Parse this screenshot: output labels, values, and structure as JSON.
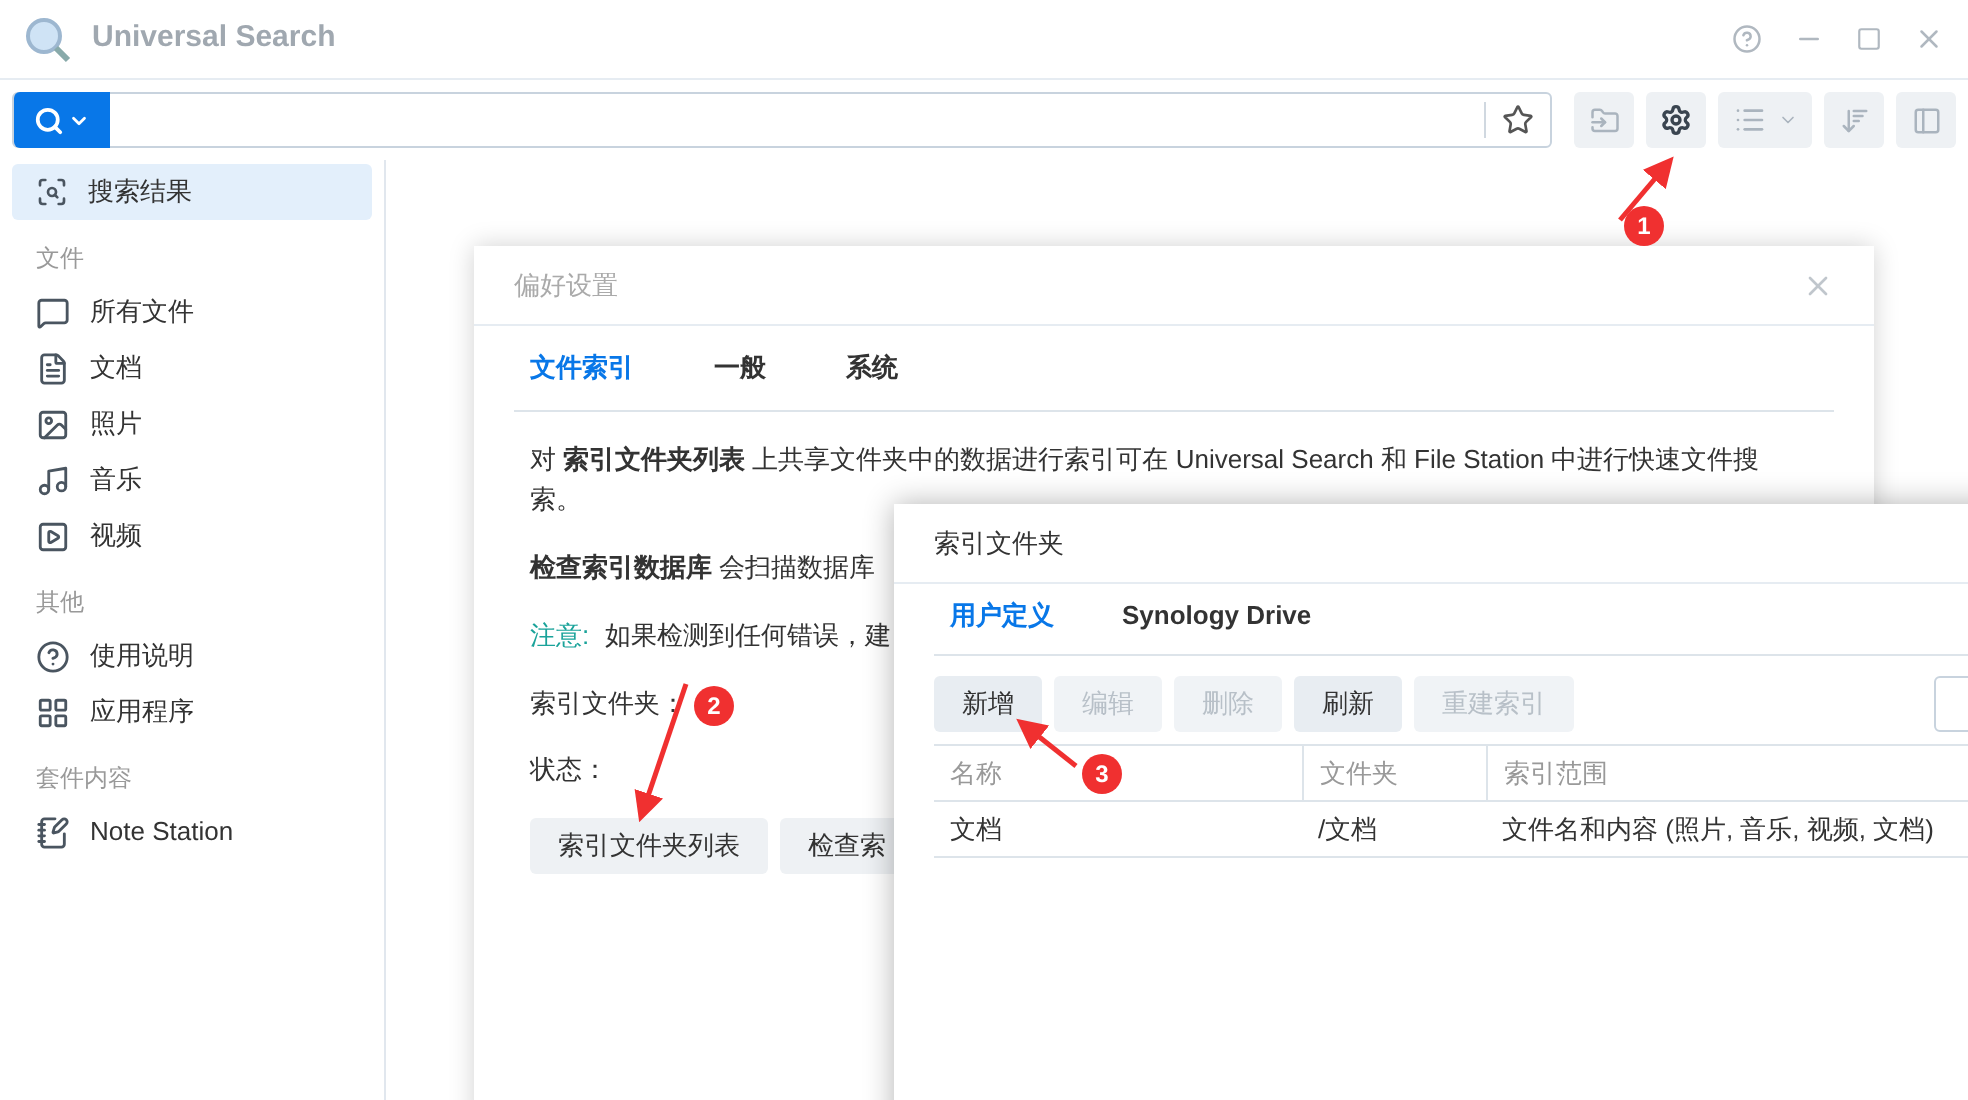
{
  "window": {
    "title": "Universal Search"
  },
  "sidebar": {
    "items": [
      {
        "label": "搜索结果",
        "selected": true
      }
    ],
    "sections": [
      {
        "heading": "文件",
        "items": [
          {
            "label": "所有文件",
            "selected": false
          },
          {
            "label": "文档",
            "selected": false
          },
          {
            "label": "照片",
            "selected": false
          },
          {
            "label": "音乐",
            "selected": false
          },
          {
            "label": "视频",
            "selected": false
          }
        ]
      },
      {
        "heading": "其他",
        "items": [
          {
            "label": "使用说明",
            "selected": false
          },
          {
            "label": "应用程序",
            "selected": false
          }
        ]
      },
      {
        "heading": "套件内容",
        "items": [
          {
            "label": "Note Station",
            "selected": false
          }
        ]
      }
    ]
  },
  "preferences": {
    "title": "偏好设置",
    "tabs": [
      {
        "label": "文件索引",
        "selected": true
      },
      {
        "label": "一般",
        "selected": false
      },
      {
        "label": "系统",
        "selected": false
      }
    ],
    "paragraphs": [
      "对 **索引文件夹列表** 上共享文件夹中的数据进行索引可在 Universal Search 和 File Station 中进行快速文件搜索。",
      "**检查索引数据库** 会扫描数据库"
    ],
    "note": {
      "label": "注意:",
      "text": "如果检测到任何错误，建"
    },
    "fields": [
      "索引文件夹：",
      "状态："
    ],
    "buttons": [
      "索引文件夹列表",
      "检查索"
    ]
  },
  "index_folders": {
    "title": "索引文件夹",
    "tabs": [
      {
        "label": "用户定义",
        "selected": true
      },
      {
        "label": "Synology Drive",
        "selected": false
      }
    ],
    "buttons": [
      {
        "label": "新增",
        "disabled": false
      },
      {
        "label": "编辑",
        "disabled": true
      },
      {
        "label": "删除",
        "disabled": true
      },
      {
        "label": "刷新",
        "disabled": false
      },
      {
        "label": "重建索引",
        "disabled": true
      }
    ],
    "table": {
      "columns": [
        "名称",
        "文件夹",
        "索引范围"
      ],
      "rows": [
        [
          "文档",
          "/文档",
          "文件名和内容 (照片, 音乐, 视频, 文档)"
        ]
      ]
    }
  },
  "annotations": [
    "1",
    "2",
    "3"
  ]
}
